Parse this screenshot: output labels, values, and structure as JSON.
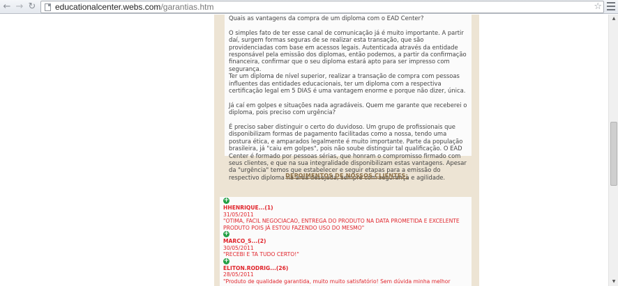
{
  "browser": {
    "url_host": "educationalcenter.webs.com",
    "url_path": "/garantias.htm",
    "back_glyph": "←",
    "forward_glyph": "→",
    "reload_glyph": "↻",
    "star_glyph": "☆"
  },
  "article": {
    "paragraphs": [
      "Quais as vantagens da compra de um diploma com o EAD Center?",
      "O simples fato de ter esse canal de comunicação já é muito importante. A partir daí, surgem formas seguras de se realizar esta transação, que são providenciadas com base em acessos legais. Autenticada através da entidade responsável pela emissão dos diplomas, então podemos, a partir da confirmação financeira, confirmar que o seu diploma estará apto para ser impresso com segurança.",
      "Ter um diploma de nível superior, realizar a transação de compra com pessoas influentes das entidades educacionais, ter um diploma com a respectiva certificação legal em 5 DIAS é uma vantagem enorme e porque não dizer, única.",
      "Já caí em golpes e situações nada agradáveis. Quem me garante que receberei o diploma, pois preciso com urgência?",
      "É preciso saber distinguir o certo do duvidoso. Um grupo de profissionais que disponibilizam formas de pagamento facilitadas como a nossa, tendo uma postura ética, e amparados legalmente é muito importante. Parte da população brasileira, já \"caiu em golpes\", pois não soube distinguir tal qualificação. O EAD Center é formado por pessoas sérias, que honram o compromisso firmado com seus clientes, e que na sua integralidade disponibilizam estas vantagens. Apesar da \"urgência\" temos que estabelecer e seguir etapas para a emissão do respectivo diploma na área desejada, sempre com segurança e agilidade."
    ]
  },
  "testimonials": {
    "title": "DEPOIMENTOS DE NOSSOS CLIENTES:",
    "plus_glyph": "+",
    "items": [
      {
        "name": "HHENRIQUE...(1)",
        "date": "31/05/2011",
        "text": "\"OTIMA, FACIL NEGOCIACAO, ENTREGA DO PRODUTO NA DATA PROMETIDA E EXCELENTE PRODUTO POIS JÁ ESTOU FAZENDO USO DO MESMO\""
      },
      {
        "name": "MARCO_S...(2)",
        "date": "30/05/2011",
        "text": "\"RECEBI E TA TUDO CERTO!\""
      },
      {
        "name": "ELITON.RODRIG...(26)",
        "date": "28/05/2011",
        "text": "\"Produto de qualidade garantida, muito muito satisfatório! Sem dúvida minha melhor compra no"
      }
    ]
  },
  "scrollbar": {
    "up_glyph": "▲",
    "down_glyph": "▼"
  }
}
